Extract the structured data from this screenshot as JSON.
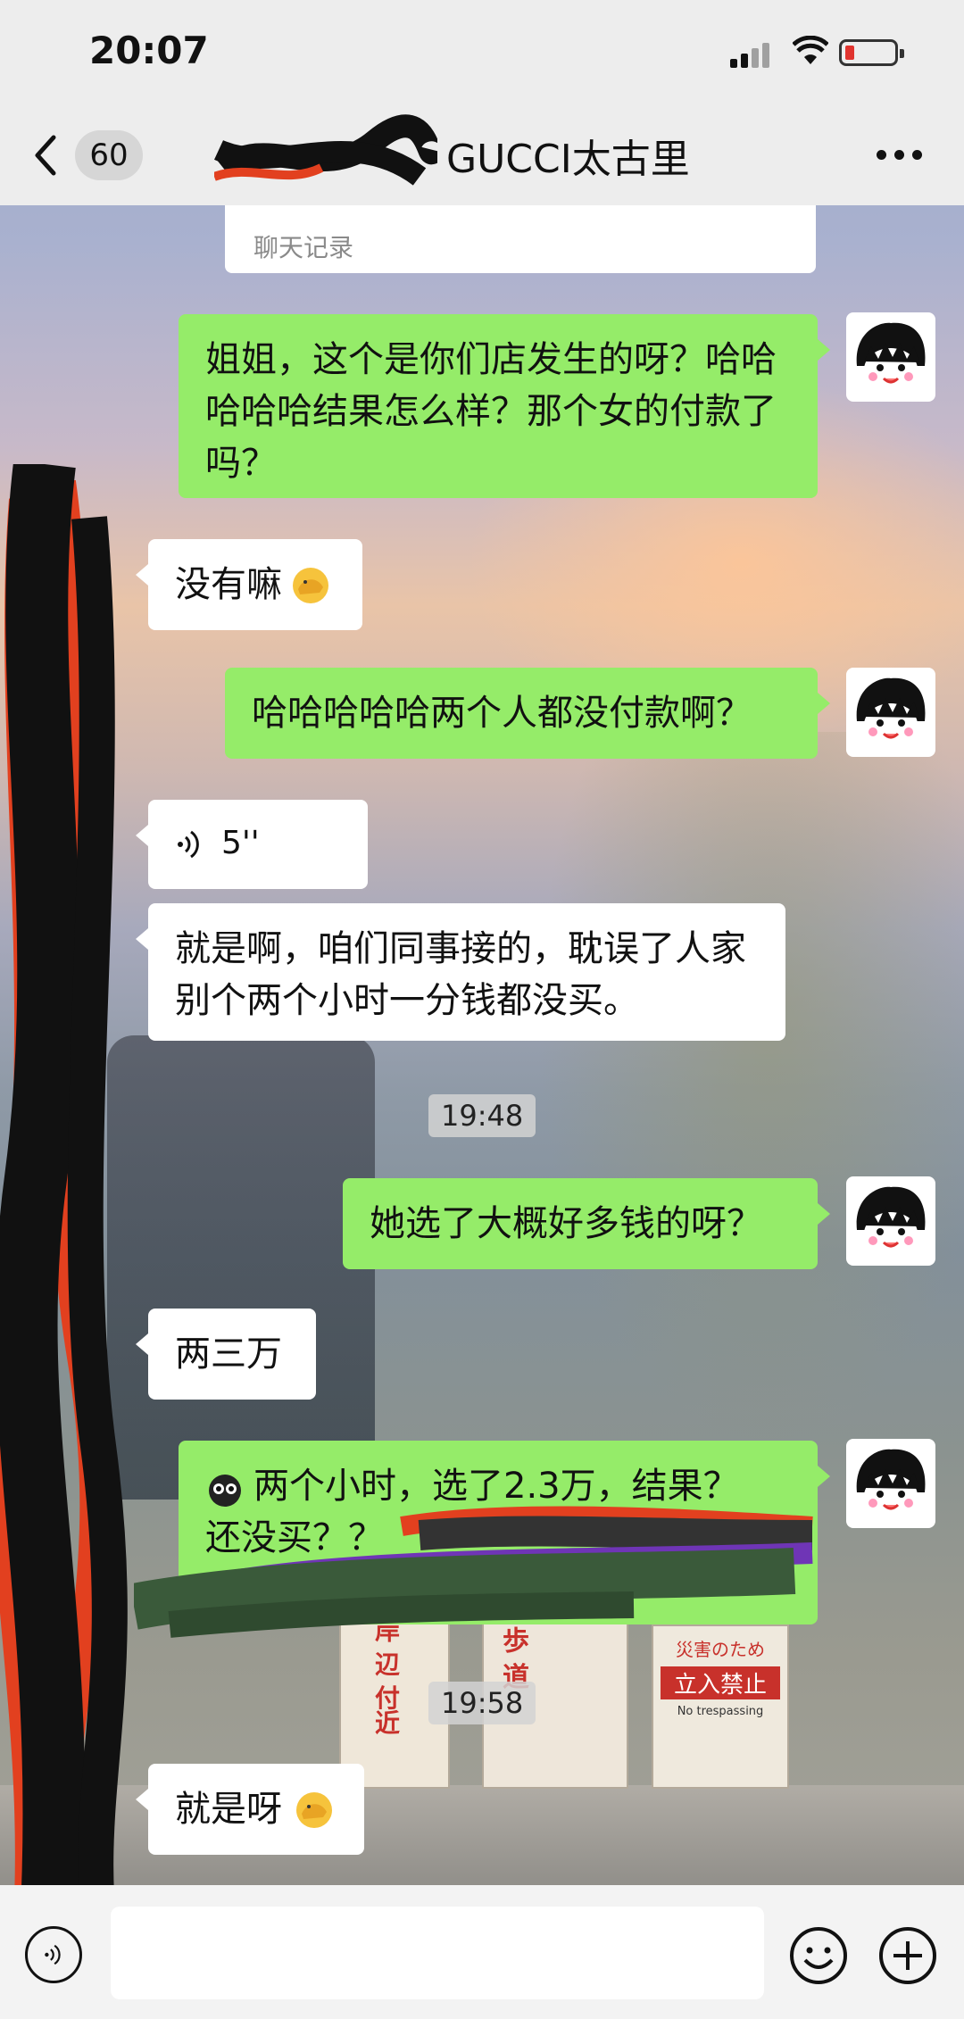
{
  "status_bar": {
    "time": "20:07"
  },
  "header": {
    "unread_count": "60",
    "title": "GUCCI太古里"
  },
  "quoted": {
    "label": "聊天记录"
  },
  "messages": [
    {
      "side": "out",
      "text": "姐姐，这个是你们店发生的呀？哈哈哈哈哈结果怎么样？那个女的付款了吗？"
    },
    {
      "side": "in",
      "text": "没有嘛",
      "emoji": "facepalm-emoji"
    },
    {
      "side": "out",
      "text": "哈哈哈哈哈两个人都没付款啊？"
    },
    {
      "side": "in",
      "type": "voice",
      "duration": "5''"
    },
    {
      "side": "in",
      "text": "就是啊，咱们同事接的，耽误了人家别个两个小时一分钱都没买。"
    },
    {
      "timestamp": "19:48"
    },
    {
      "side": "out",
      "text": "她选了大概好多钱的呀？"
    },
    {
      "side": "in",
      "text": "两三万"
    },
    {
      "side": "out",
      "text_line1": "两个小时，选了2.3万，结果？",
      "text_line2": "还没买？？",
      "emoji": "shocked-emoji"
    },
    {
      "timestamp": "19:58"
    },
    {
      "side": "in",
      "text": "就是呀",
      "emoji": "facepalm-emoji"
    }
  ],
  "background_signs": {
    "sign1_title": "災害のため",
    "sign1_main": "立入禁止",
    "sign1_sub": "No trespassing",
    "sign2": "岸 辺 付近",
    "sign3": "歩 道"
  },
  "colors": {
    "outgoing_bubble": "#95ec69",
    "incoming_bubble": "#ffffff",
    "chrome": "#ededed"
  },
  "icons": {
    "back": "chevron-left-icon",
    "more": "more-icon",
    "voice": "voice-icon",
    "emoji": "emoji-icon",
    "plus": "plus-icon"
  }
}
